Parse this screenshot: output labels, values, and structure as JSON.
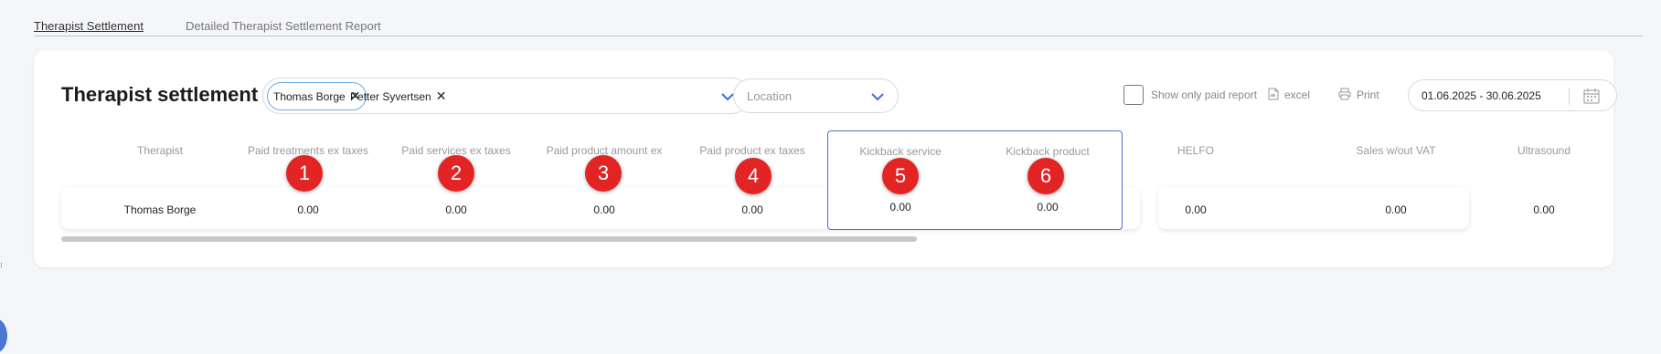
{
  "tabs": [
    {
      "label": "Therapist Settlement",
      "active": true
    },
    {
      "label": "Detailed Therapist Settlement Report",
      "active": false
    }
  ],
  "page": {
    "title": "Therapist settlement"
  },
  "therapist_filter": {
    "chips": [
      {
        "label": "Thomas Borge",
        "selected": true
      },
      {
        "label": "Petter Syvertsen",
        "selected": false
      }
    ],
    "remove_icon": "close-icon",
    "dropdown_icon": "chevron-down-icon"
  },
  "location_filter": {
    "placeholder": "Location"
  },
  "toolbar": {
    "show_paid_label": "Show only paid report",
    "show_paid_checked": false,
    "excel_label": "excel",
    "excel_icon": "file-icon",
    "print_label": "Print",
    "print_icon": "printer-icon"
  },
  "date_range": {
    "value": "01.06.2025 - 30.06.2025",
    "icon": "calendar-icon"
  },
  "table": {
    "columns": [
      "Therapist",
      "Paid treatments ex taxes",
      "Paid services ex taxes",
      "Paid product amount ex",
      "Paid product ex taxes",
      "Kickback service",
      "Kickback product",
      "HELFO",
      "Sales w/out VAT",
      "Ultrasound"
    ],
    "rows": [
      [
        "Thomas Borge",
        "0.00",
        "0.00",
        "0.00",
        "0.00",
        "0.00",
        "0.00",
        "0.00",
        "0.00",
        "0.00"
      ]
    ]
  },
  "annotations": [
    "1",
    "2",
    "3",
    "4",
    "5",
    "6"
  ],
  "colors": {
    "accent": "#4a6fc9",
    "badge": "#e32424",
    "chip_border": "#6ea8e5"
  }
}
